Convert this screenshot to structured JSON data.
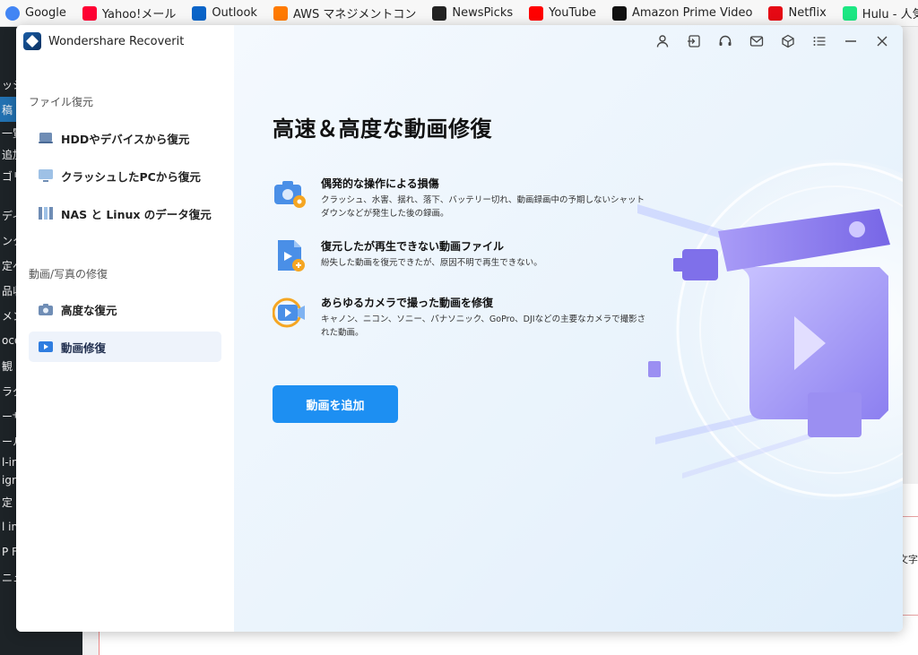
{
  "browser": {
    "bookmarks": [
      {
        "label": "Google",
        "icon": "google-icon",
        "color": "#4285f4"
      },
      {
        "label": "Yahoo!メール",
        "icon": "yahoo-mail-icon",
        "color": "#ff0033"
      },
      {
        "label": "Outlook",
        "icon": "outlook-icon",
        "color": "#0a64c8"
      },
      {
        "label": "AWS マネジメントコン",
        "icon": "aws-icon",
        "color": "#ff7a00"
      },
      {
        "label": "NewsPicks",
        "icon": "newspicks-icon",
        "color": "#222222"
      },
      {
        "label": "YouTube",
        "icon": "youtube-icon",
        "color": "#ff0000"
      },
      {
        "label": "Amazon Prime Video",
        "icon": "amazon-icon",
        "color": "#111111"
      },
      {
        "label": "Netflix",
        "icon": "netflix-icon",
        "color": "#e50914"
      },
      {
        "label": "Hulu - 人気映画・ド",
        "icon": "hulu-icon",
        "color": "#1ce783"
      }
    ]
  },
  "background_sidebar": {
    "items": [
      "ッシ",
      "稿",
      "一覧",
      "追加",
      "ゴリー",
      "ディ",
      "ンク",
      "定ペ",
      "品収",
      "メン",
      "ocoo",
      "観",
      "ラグ",
      "ーザ",
      "ール",
      "l-in",
      "igra",
      "定",
      "l in",
      "P Fa",
      "ニュ"
    ]
  },
  "background_fragment": "文字",
  "app": {
    "title": "Wondershare Recoverit",
    "sidebar": {
      "section1": "ファイル復元",
      "section1_items": [
        {
          "label": "HDDやデバイスから復元",
          "icon": "hdd-icon"
        },
        {
          "label": "クラッシュしたPCから復元",
          "icon": "monitor-icon"
        },
        {
          "label": "NAS と Linux のデータ復元",
          "icon": "nas-icon"
        }
      ],
      "section2": "動画/写真の修復",
      "section2_items": [
        {
          "label": "高度な復元",
          "icon": "camera-icon"
        },
        {
          "label": "動画修復",
          "icon": "video-repair-icon",
          "active": true
        }
      ]
    },
    "topbar": [
      "user-icon",
      "sign-in-icon",
      "headset-icon",
      "mail-icon",
      "cube-icon",
      "menu-icon",
      "minimize-icon",
      "close-icon"
    ],
    "main": {
      "heading": "高速＆高度な動画修復",
      "features": [
        {
          "title": "偶発的な操作による損傷",
          "desc": "クラッシュ、水害、揺れ、落下、バッテリー切れ、動画録画中の予期しないシャットダウンなどが発生した後の録画。",
          "icon": "camera-gear-icon"
        },
        {
          "title": "復元したが再生できない動画ファイル",
          "desc": "紛失した動画を復元できたが、原因不明で再生できない。",
          "icon": "file-repair-icon"
        },
        {
          "title": "あらゆるカメラで撮った動画を修復",
          "desc": "キャノン、ニコン、ソニー、パナソニック、GoPro、DJIなどの主要なカメラで撮影された動画。",
          "icon": "camera-video-icon"
        }
      ],
      "button": "動画を追加"
    },
    "colors": {
      "accent": "#1d8ff2",
      "active_nav": "#eef3fb",
      "illustration": "#8c7ff0"
    }
  }
}
